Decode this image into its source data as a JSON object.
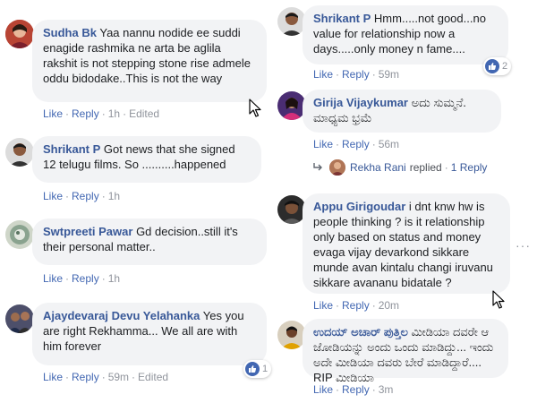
{
  "comments_left": [
    {
      "author": "Sudha Bk",
      "text": "Yaa nannu nodide ee suddi enagide rashmika ne arta be aglila rakshit is not stepping stone rise admele oddu bidodake..This is not the way",
      "like": "Like",
      "reply": "Reply",
      "time": "1h",
      "edited": "Edited"
    },
    {
      "author": "Shrikant P",
      "text": "Got news that she signed 12 telugu films. So ..........happened",
      "like": "Like",
      "reply": "Reply",
      "time": "1h"
    },
    {
      "author": "Swtpreeti Pawar",
      "text": "Gd decision..still it's their personal matter..",
      "like": "Like",
      "reply": "Reply",
      "time": "1h"
    },
    {
      "author": "Ajaydevaraj Devu Yelahanka",
      "text": "Yes you are right Rekhamma... We all are with him forever",
      "like": "Like",
      "reply": "Reply",
      "time": "59m",
      "edited": "Edited",
      "reaction_count": "1"
    }
  ],
  "comments_right": [
    {
      "author": "Shrikant P",
      "text": "Hmm.....not good...no value for relationship now a days.....only money n fame....",
      "like": "Like",
      "reply": "Reply",
      "time": "59m",
      "reaction_count": "2"
    },
    {
      "author": "Girija Vijaykumar",
      "text": "ಅದು ಸುಮ್ಮನೆ. ಮಾಧ್ಯಮ ಭ್ರಮೆ",
      "like": "Like",
      "reply": "Reply",
      "time": "56m",
      "replied_by": "Rekha Rani",
      "replied_word": "replied",
      "reply_count": "1 Reply"
    },
    {
      "author": "Appu Girigoudar",
      "text": "i dnt knw hw is people thinking ? is it relationship only based on status and money evaga vijay devarkond sikkare munde avan kintalu changi iruvanu sikkare avananu bidatale ?",
      "like": "Like",
      "reply": "Reply",
      "time": "20m"
    },
    {
      "author": "ಉದಯ್ ಅಚಾರ್ ಪುತ್ತಿಲ",
      "text": "ಮೀಡಿಯಾ ದವರೇ ಆ ಜೋಡಿಯನ್ನು ಅಂದು ಒಂದು ಮಾಡಿದ್ದು... ಇಂದು ಅದೇ ಮೀಡಿಯಾ ದವರು ಬೇರೆ ಮಾಡಿದ್ದಾರೆ.... RIP ಮೀಡಿಯಾ",
      "like": "Like",
      "reply": "Reply",
      "time": "3m"
    }
  ],
  "colors": {
    "author": "#385898",
    "link": "#4267b2",
    "bubble": "#f2f3f5",
    "meta": "#90949c"
  },
  "icons": {
    "like_reaction": "thumbs-up-icon",
    "reply_arrow": "reply-arrow-icon",
    "cursor": "mouse-cursor-icon",
    "more": "more-options-icon"
  },
  "more_label": "···"
}
